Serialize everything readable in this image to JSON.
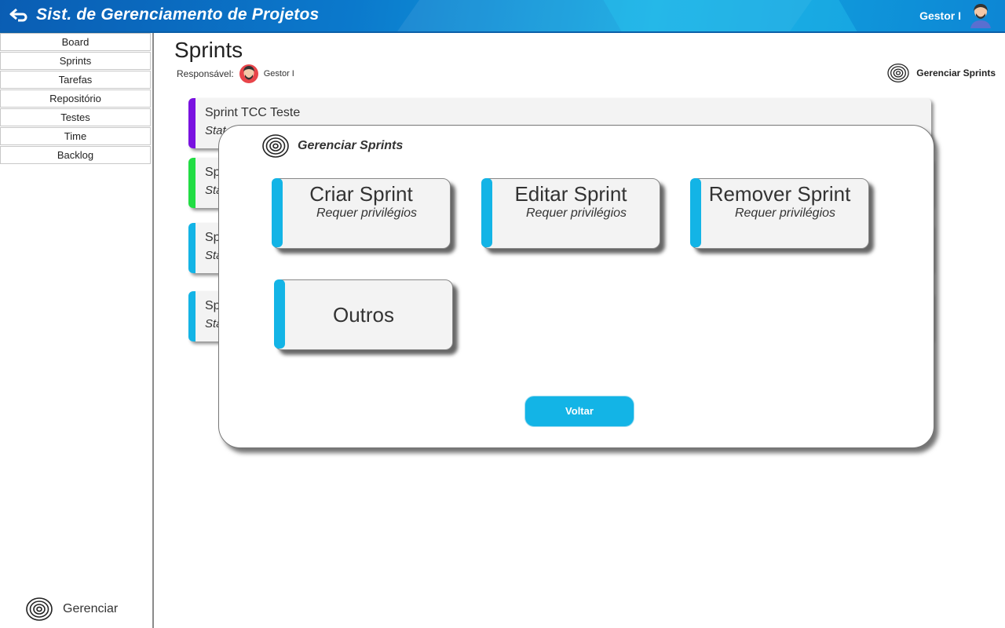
{
  "header": {
    "title": "Sist. de Gerenciamento de Projetos",
    "user_name": "Gestor I",
    "colors": {
      "bar": "#0b79cc",
      "accent": "#13b4e6"
    }
  },
  "sidebar": {
    "items": [
      {
        "label": "Board"
      },
      {
        "label": "Sprints"
      },
      {
        "label": "Tarefas"
      },
      {
        "label": "Repositório"
      },
      {
        "label": "Testes"
      },
      {
        "label": "Time"
      },
      {
        "label": "Backlog"
      }
    ],
    "manage_label": "Gerenciar"
  },
  "page": {
    "title": "Sprints",
    "responsible_label": "Responsável:",
    "responsible_name": "Gestor I",
    "manage_link": "Gerenciar Sprints"
  },
  "sprints": [
    {
      "name": "Sprint TCC Teste",
      "status": "Stat",
      "color": "#7a12e0"
    },
    {
      "name": "Sp",
      "status": "Sta",
      "color": "#22dd44"
    },
    {
      "name": "Sp",
      "status": "Sta",
      "color": "#13b4e6"
    },
    {
      "name": "Sp",
      "status": "Sta",
      "color": "#13b4e6"
    }
  ],
  "modal": {
    "title": "Gerenciar Sprints",
    "options": [
      {
        "label": "Criar Sprint",
        "sub": "Requer privilégios"
      },
      {
        "label": "Editar Sprint",
        "sub": "Requer privilégios"
      },
      {
        "label": "Remover Sprint",
        "sub": "Requer privilégios"
      },
      {
        "label": "Outros"
      }
    ],
    "back_button": "Voltar"
  }
}
